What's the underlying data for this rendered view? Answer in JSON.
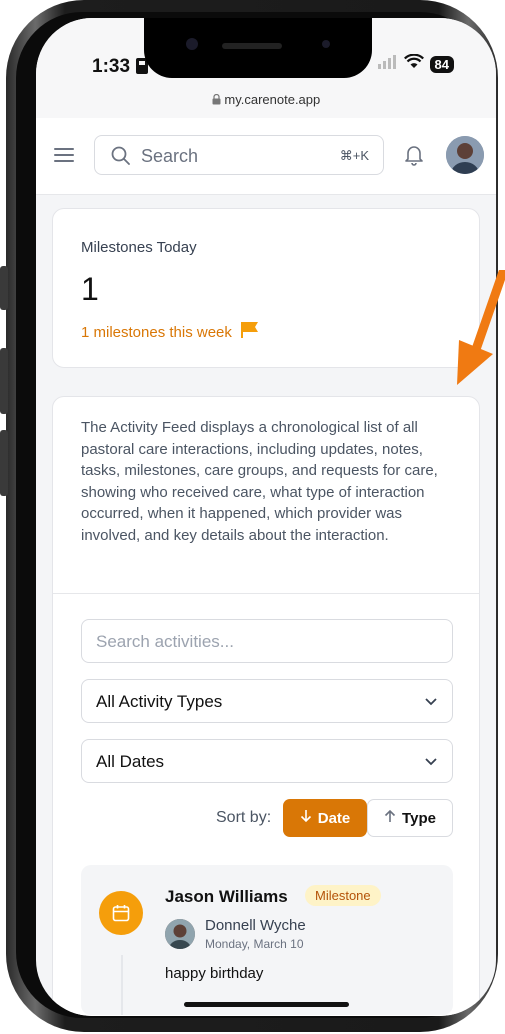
{
  "status_bar": {
    "time": "1:33",
    "battery": "84"
  },
  "browser": {
    "url": "my.carenote.app"
  },
  "header": {
    "search_placeholder": "Search",
    "search_shortcut": "⌘+K"
  },
  "milestones_card": {
    "title": "Milestones Today",
    "value": "1",
    "subtitle": "1 milestones this week"
  },
  "activity_feed": {
    "description": "The Activity Feed displays a chronological list of all pastoral care interactions, including updates, notes, tasks, milestones, care groups, and requests for care, showing who received care, what type of interaction occurred, when it happened, which provider was involved, and key details about the interaction.",
    "search_placeholder": "Search activities...",
    "type_filter": "All Activity Types",
    "date_filter": "All Dates",
    "sort_label": "Sort by:",
    "sort_date": "Date",
    "sort_type": "Type",
    "items": [
      {
        "recipient": "Jason Williams",
        "badge": "Milestone",
        "provider": "Donnell Wyche",
        "date": "Monday, March 10",
        "note": "happy birthday"
      }
    ]
  },
  "colors": {
    "accent": "#d97706",
    "milestone_icon": "#f59e0b",
    "badge_bg": "#fef3c7"
  }
}
